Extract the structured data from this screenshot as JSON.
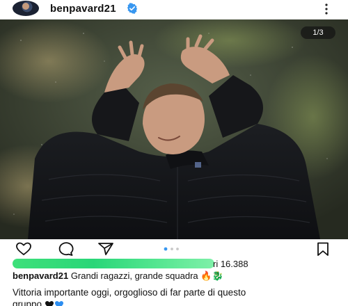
{
  "post": {
    "username": "benpavard21",
    "counter": "1/3",
    "likes_suffix": "ri 16.388",
    "caption_user": "benpavard21",
    "caption_text": " Grandi ragazzi, grande squadra ",
    "caption_emojis": "🔥🐉",
    "body_text_1": "Vittoria importante oggi, orgoglioso di far parte di questo",
    "body_text_2": "gruppo"
  },
  "icons": {
    "verified": "verified-badge-icon",
    "more": "more-vertical-icon",
    "like": "heart-icon",
    "comment": "comment-icon",
    "share": "send-icon",
    "save": "bookmark-icon",
    "hearts": "black-blue-hearts-icon"
  },
  "colors": {
    "verified": "#3897f0",
    "carousel_active": "#3897f0",
    "redaction": "#2ed47a"
  }
}
